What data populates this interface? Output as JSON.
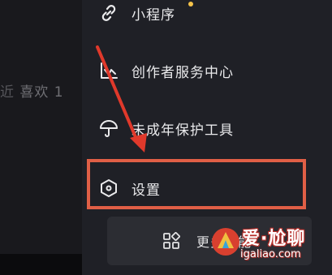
{
  "left_panel": {
    "likes_text": "喜欢 1"
  },
  "menu": {
    "items": [
      {
        "label": "小程序",
        "icon": "link-icon",
        "has_dot": true
      },
      {
        "label": "创作者服务中心",
        "icon": "chart-icon"
      },
      {
        "label": "未成年保护工具",
        "icon": "umbrella-icon"
      },
      {
        "label": "设置",
        "icon": "hexagon-settings-icon"
      }
    ],
    "more_button": {
      "label": "更多功能",
      "icon": "grid-icon"
    }
  },
  "annotation": {
    "highlight_color": "#e05f46",
    "arrow_color": "#e0392b"
  },
  "watermark": {
    "brand": "爱·尬聊",
    "url": "igaliao.com"
  },
  "colors": {
    "background": "#141418",
    "menu_background": "#1f2026",
    "notification_dot": "#f5c34a"
  }
}
